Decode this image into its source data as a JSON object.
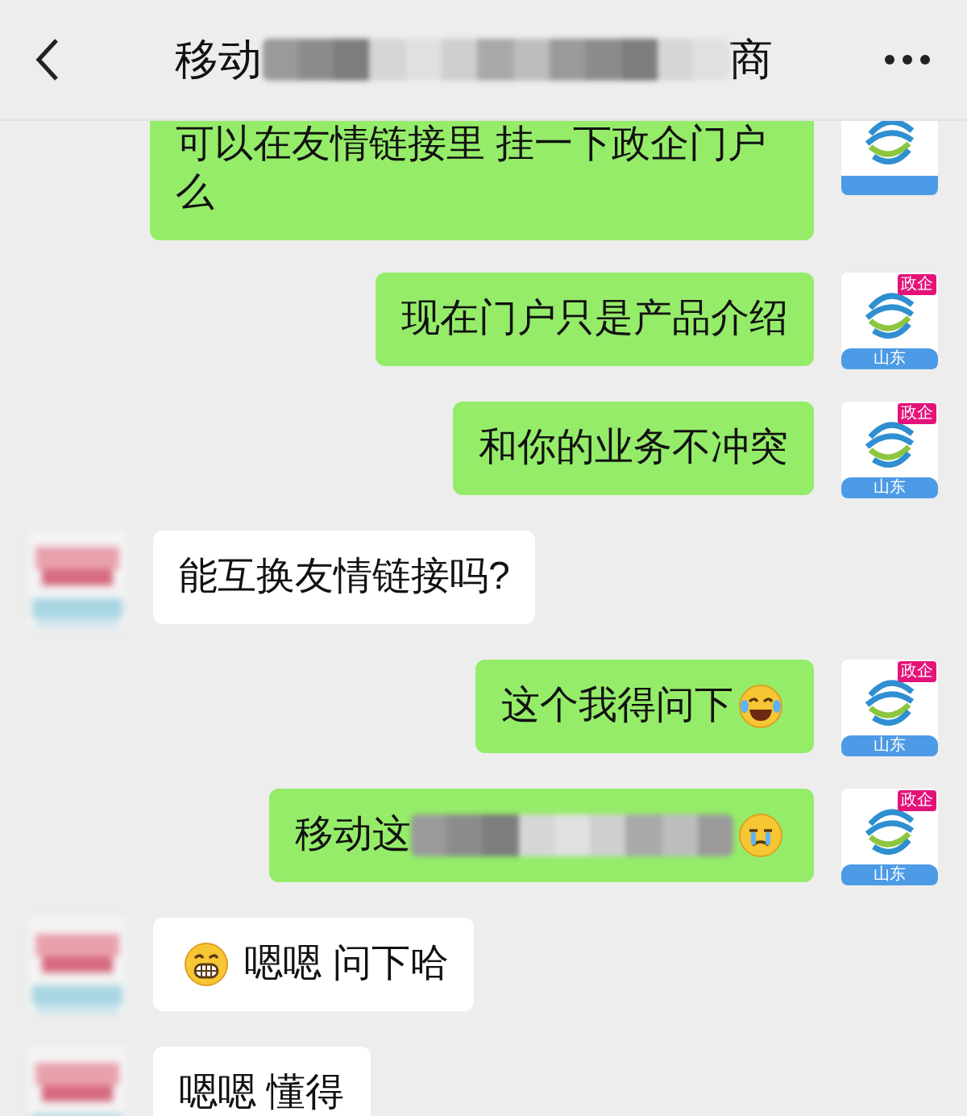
{
  "header": {
    "title_parts": [
      {
        "kind": "text",
        "text": "移动"
      },
      {
        "kind": "blur"
      },
      {
        "kind": "text",
        "text": "商"
      }
    ]
  },
  "messages": [
    {
      "kind": "outgoing",
      "avatar": {
        "kind": "logo"
      },
      "parts": [
        {
          "kind": "text",
          "text": "可以在友情链接里 挂一下政企门户么"
        }
      ]
    },
    {
      "kind": "outgoing",
      "avatar": {
        "kind": "logo",
        "badge": "政企",
        "region": "山东"
      },
      "parts": [
        {
          "kind": "text",
          "text": "现在门户只是产品介绍"
        }
      ]
    },
    {
      "kind": "outgoing",
      "avatar": {
        "kind": "logo",
        "badge": "政企",
        "region": "山东"
      },
      "parts": [
        {
          "kind": "text",
          "text": "和你的业务不冲突"
        }
      ]
    },
    {
      "kind": "incoming",
      "avatar": {
        "kind": "blurred"
      },
      "parts": [
        {
          "kind": "text",
          "text": "能互换友情链接吗?"
        }
      ]
    },
    {
      "kind": "outgoing",
      "avatar": {
        "kind": "logo",
        "badge": "政企",
        "region": "山东"
      },
      "parts": [
        {
          "kind": "text",
          "text": "这个我得问下"
        },
        {
          "kind": "laughing"
        }
      ]
    },
    {
      "kind": "outgoing",
      "avatar": {
        "kind": "logo",
        "badge": "政企",
        "region": "山东"
      },
      "parts": [
        {
          "kind": "text",
          "text": "移动这"
        },
        {
          "kind": "blur"
        },
        {
          "kind": "crying"
        }
      ]
    },
    {
      "kind": "incoming",
      "avatar": {
        "kind": "blurred"
      },
      "parts": [
        {
          "kind": "grinning"
        },
        {
          "kind": "text",
          "text": " 嗯嗯 问下哈"
        }
      ]
    },
    {
      "kind": "incoming",
      "avatar": {
        "kind": "blurred"
      },
      "parts": [
        {
          "kind": "text",
          "text": "嗯嗯 懂得"
        }
      ]
    }
  ]
}
